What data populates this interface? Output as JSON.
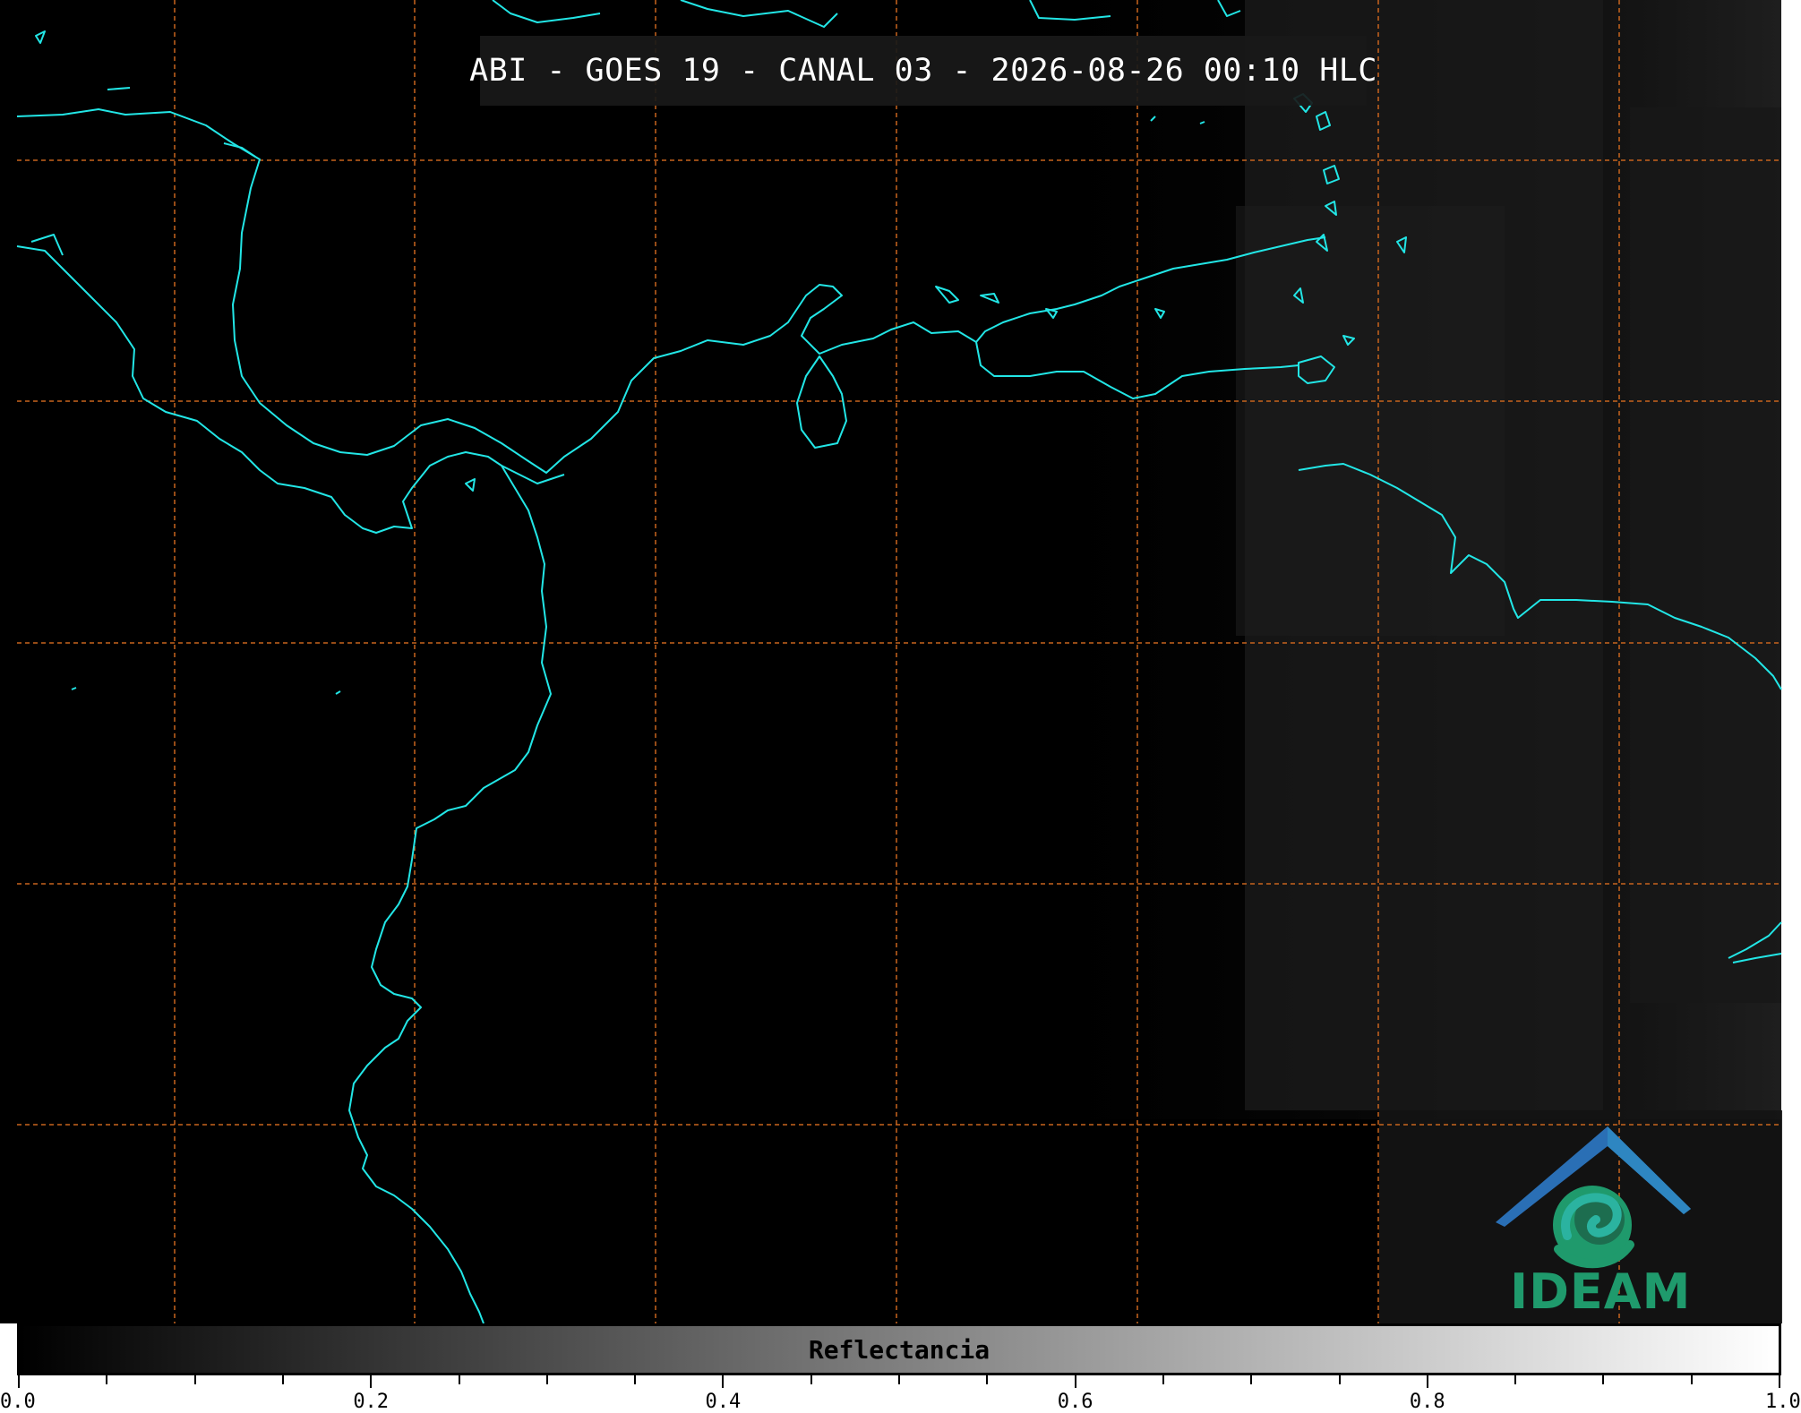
{
  "title": "ABI - GOES 19 - CANAL 03 - 2026-08-26 00:10 HLC",
  "colors": {
    "background": "#000000",
    "coastline": "#22e6e6",
    "graticule": "#c8641e",
    "logo_primary": "#1f9a6c",
    "logo_secondary": "#2a6fb5"
  },
  "colorbar": {
    "label": "Reflectancia",
    "min": 0.0,
    "max": 1.0,
    "ticks": [
      "0.0",
      "0.2",
      "0.4",
      "0.6",
      "0.8",
      "1.0"
    ],
    "gradient": [
      "#000000",
      "#ffffff"
    ]
  },
  "logo": {
    "text": "IDEAM",
    "icon": "ideam-logo-icon"
  },
  "map": {
    "graticule": "dashed",
    "coastlines": "Central America, Caribbean, northern South America"
  }
}
